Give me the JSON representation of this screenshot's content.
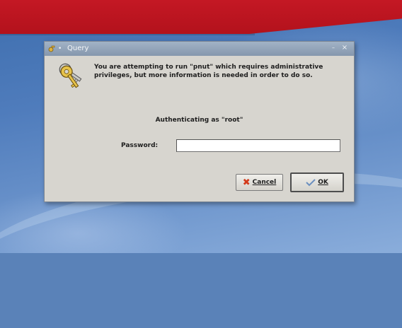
{
  "window": {
    "title": "Query",
    "pin_glyph": "•",
    "minimize_glyph": "–",
    "close_glyph": "×"
  },
  "dialog": {
    "message": "You are attempting to run \"pnut\" which requires administrative privileges, but more information is needed in order to do so.",
    "auth_text": "Authenticating as \"root\"",
    "password_label": "Password:",
    "password_value": "",
    "cancel_label": "Cancel",
    "cancel_icon_glyph": "✖",
    "ok_label": "OK"
  },
  "icons": {
    "dialog": "keys-icon",
    "cancel": "x-icon",
    "ok": "check-icon"
  },
  "colors": {
    "titlebar": "#8d9eb3",
    "dialog_bg": "#d7d5cf",
    "desktop": "#4f7cbc",
    "red_band": "#c41824",
    "cancel_icon": "#d33a1a"
  }
}
